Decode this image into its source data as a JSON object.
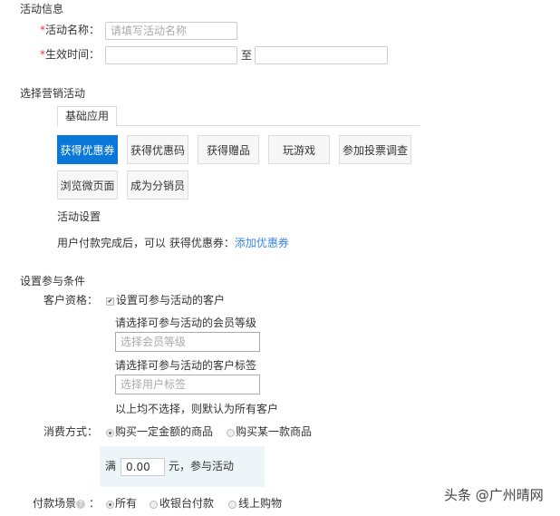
{
  "info": {
    "title": "活动信息",
    "name_label": "活动名称：",
    "name_placeholder": "请填写活动名称",
    "time_label": "生效时间：",
    "to": "至",
    "required": "*"
  },
  "marketing": {
    "title": "选择营销活动",
    "tab": "基础应用",
    "buttons": [
      "获得优惠券",
      "获得优惠码",
      "获得赠品",
      "玩游戏",
      "参加投票调查",
      "浏览微页面",
      "成为分销员"
    ],
    "settings_title": "活动设置",
    "settings_text": "用户付款完成后，可以 获得优惠券：",
    "settings_link": "添加优惠券"
  },
  "conditions": {
    "title": "设置参与条件",
    "customer_label": "客户资格：",
    "customer_checkbox": "设置可参与活动的客户",
    "level_label": "请选择可参与活动的会员等级",
    "level_placeholder": "选择会员等级",
    "tag_label": "请选择可参与活动的客户标签",
    "tag_placeholder": "选择用户标签",
    "hint": "以上均不选择，则默认为所有客户",
    "consume_label": "消费方式：",
    "consume_options": [
      "购买一定金额的商品",
      "购买某一款商品"
    ],
    "full": "满",
    "amount": "0.00",
    "amount_suffix": "元，参与活动",
    "pay_label": "付款场景",
    "pay_colon": "：",
    "pay_options": [
      "所有",
      "收银台付款",
      "线上购物"
    ]
  },
  "watermark": "头条 @广州晴网"
}
